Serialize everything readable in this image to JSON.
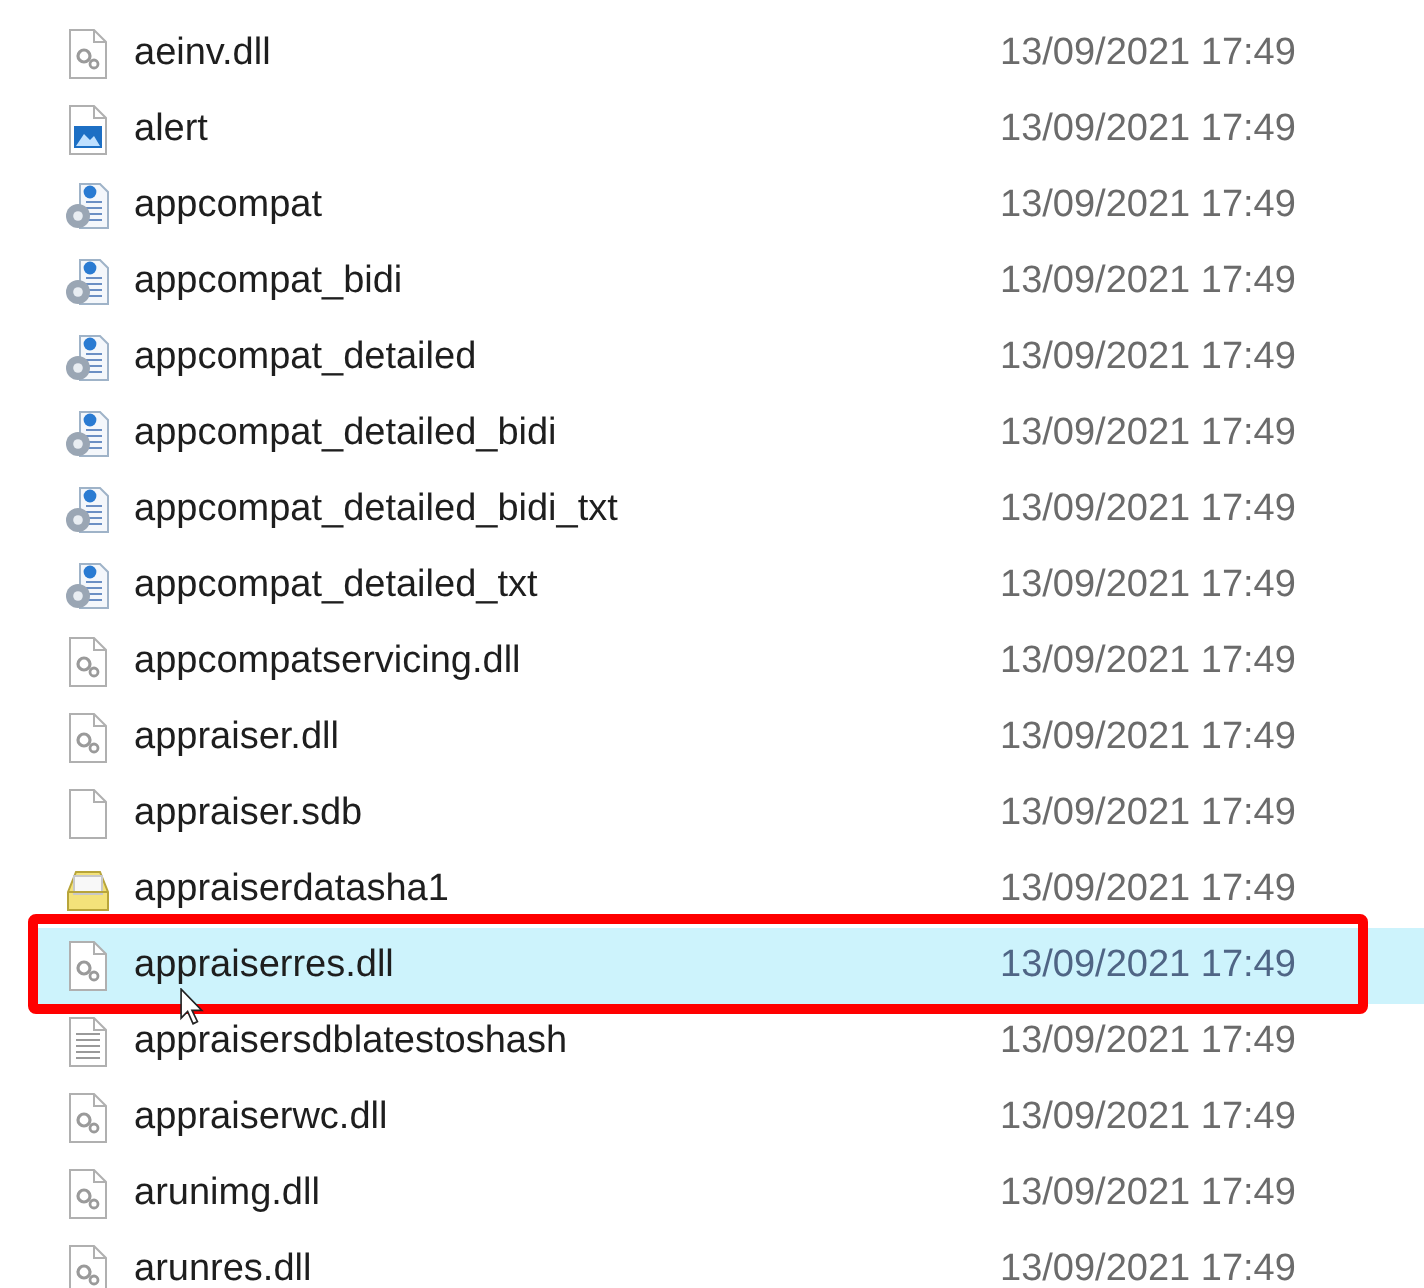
{
  "files": [
    {
      "name": "aeinv.dll",
      "date": "13/09/2021 17:49",
      "kind": "dll",
      "selected": false
    },
    {
      "name": "alert",
      "date": "13/09/2021 17:49",
      "kind": "image",
      "selected": false
    },
    {
      "name": "appcompat",
      "date": "13/09/2021 17:49",
      "kind": "config",
      "selected": false
    },
    {
      "name": "appcompat_bidi",
      "date": "13/09/2021 17:49",
      "kind": "config",
      "selected": false
    },
    {
      "name": "appcompat_detailed",
      "date": "13/09/2021 17:49",
      "kind": "config",
      "selected": false
    },
    {
      "name": "appcompat_detailed_bidi",
      "date": "13/09/2021 17:49",
      "kind": "config",
      "selected": false
    },
    {
      "name": "appcompat_detailed_bidi_txt",
      "date": "13/09/2021 17:49",
      "kind": "config",
      "selected": false
    },
    {
      "name": "appcompat_detailed_txt",
      "date": "13/09/2021 17:49",
      "kind": "config",
      "selected": false
    },
    {
      "name": "appcompatservicing.dll",
      "date": "13/09/2021 17:49",
      "kind": "dll",
      "selected": false
    },
    {
      "name": "appraiser.dll",
      "date": "13/09/2021 17:49",
      "kind": "dll",
      "selected": false
    },
    {
      "name": "appraiser.sdb",
      "date": "13/09/2021 17:49",
      "kind": "blank",
      "selected": false
    },
    {
      "name": "appraiserdatasha1",
      "date": "13/09/2021 17:49",
      "kind": "package",
      "selected": false
    },
    {
      "name": "appraiserres.dll",
      "date": "13/09/2021 17:49",
      "kind": "dll",
      "selected": true
    },
    {
      "name": "appraisersdblatestoshash",
      "date": "13/09/2021 17:49",
      "kind": "text",
      "selected": false
    },
    {
      "name": "appraiserwc.dll",
      "date": "13/09/2021 17:49",
      "kind": "dll",
      "selected": false
    },
    {
      "name": "arunimg.dll",
      "date": "13/09/2021 17:49",
      "kind": "dll",
      "selected": false
    },
    {
      "name": "arunres.dll",
      "date": "13/09/2021 17:49",
      "kind": "dll",
      "selected": false
    }
  ]
}
